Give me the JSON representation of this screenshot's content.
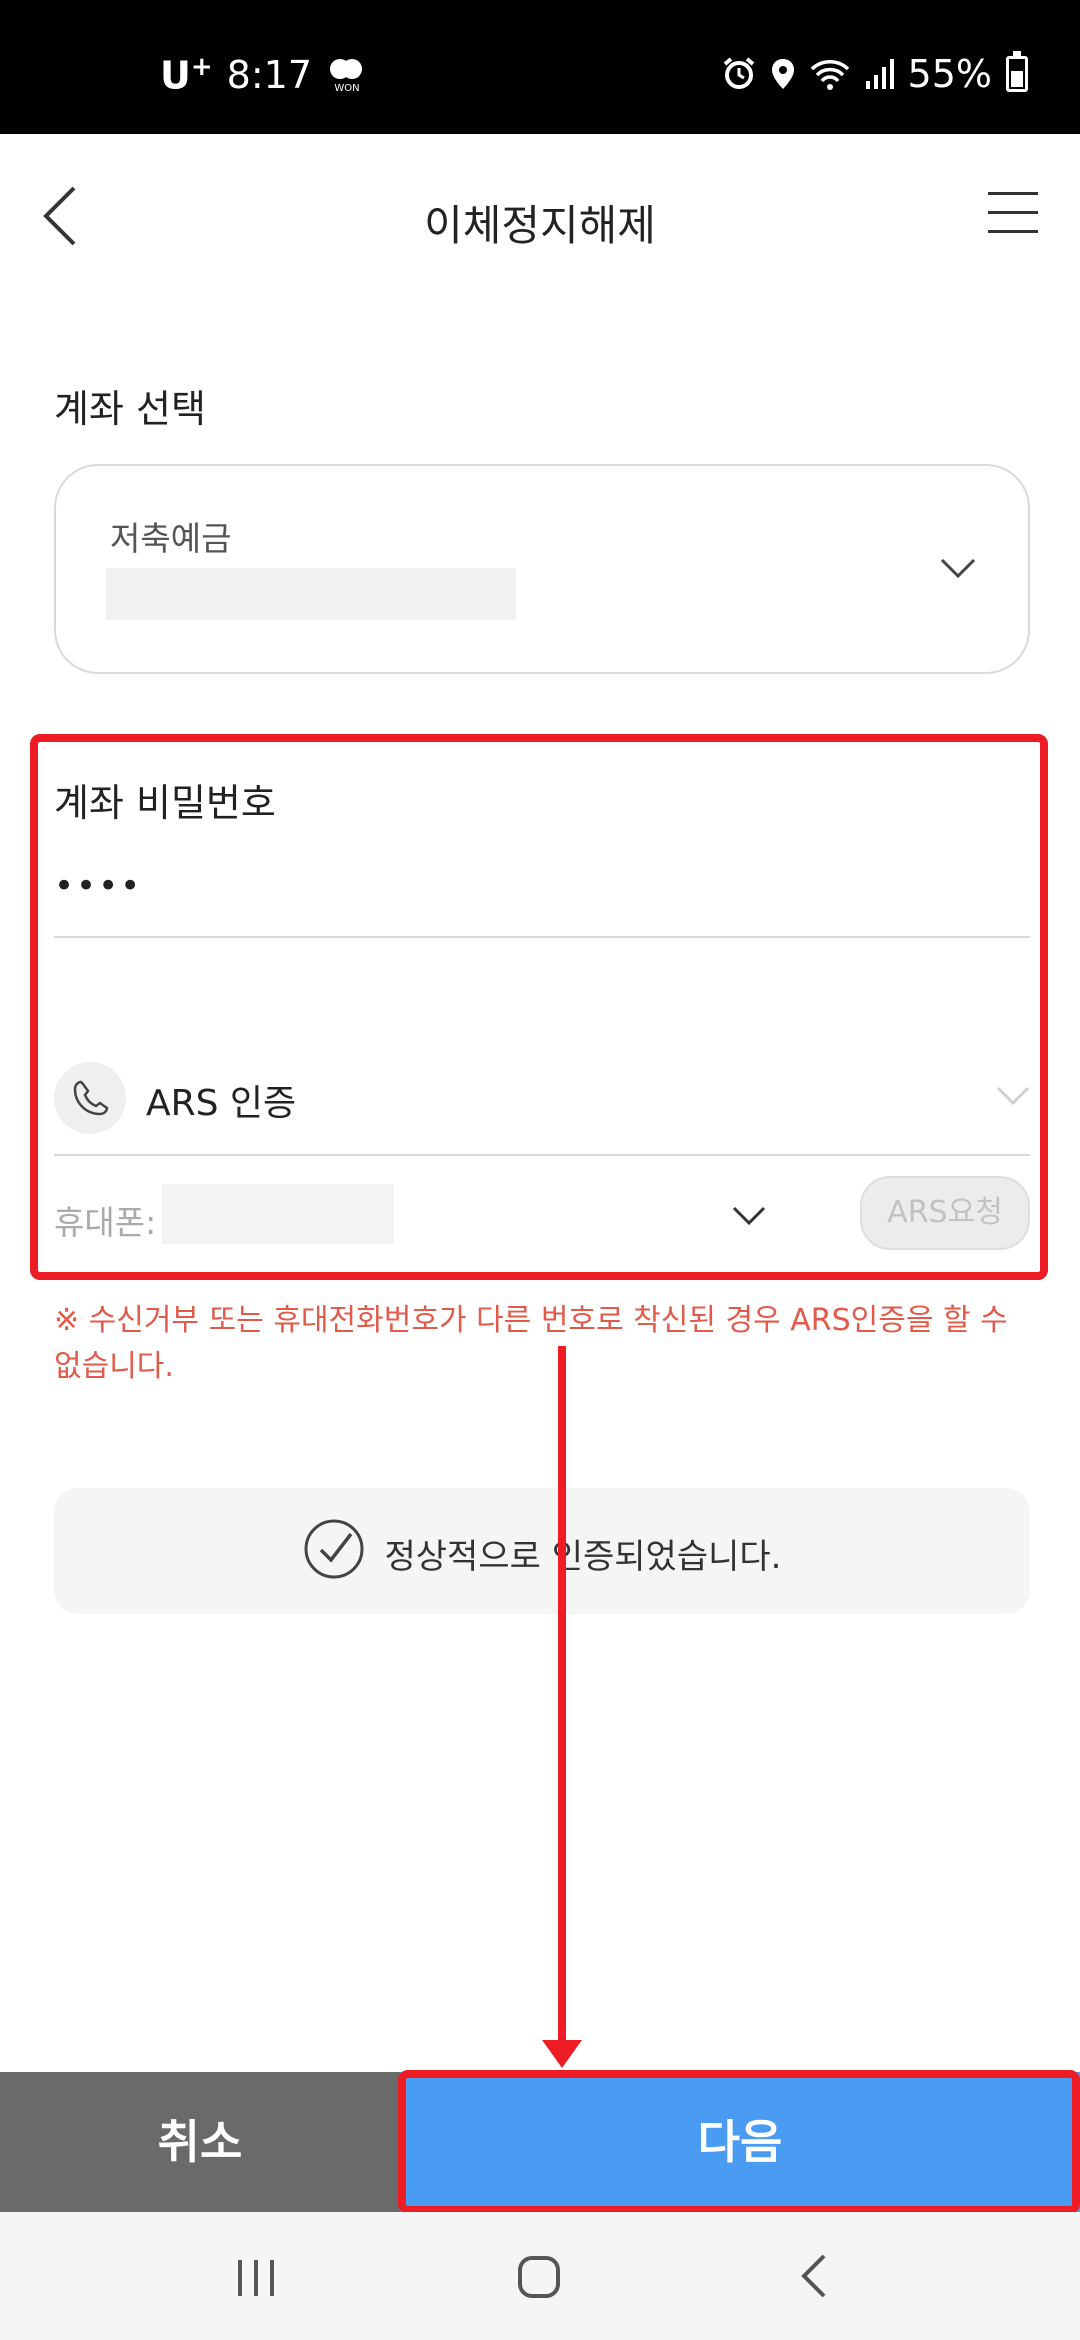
{
  "status_bar": {
    "carrier": "U",
    "carrier_sup": "+",
    "time": "8:17",
    "won_label": "WON",
    "battery": "55%"
  },
  "header": {
    "title": "이체정지해제",
    "back_icon": "chevron-left-icon",
    "menu_icon": "hamburger-menu-icon"
  },
  "account": {
    "section_label": "계좌 선택",
    "type": "저축예금"
  },
  "password": {
    "section_label": "계좌 비밀번호",
    "value": "••••"
  },
  "auth": {
    "method": "ARS 인증",
    "phone_label": "휴대폰:",
    "request_button": "ARS요청"
  },
  "notice": "※ 수신거부 또는 휴대전화번호가 다른 번호로 착신된 경우 ARS인증을 할 수 없습니다.",
  "verified_message": "정상적으로 인증되었습니다.",
  "footer": {
    "cancel": "취소",
    "next": "다음"
  },
  "colors": {
    "highlight": "#ee1c25",
    "primary": "#4a9bf2",
    "cancel_bg": "#6a6a6a",
    "notice": "#e25a4a"
  }
}
